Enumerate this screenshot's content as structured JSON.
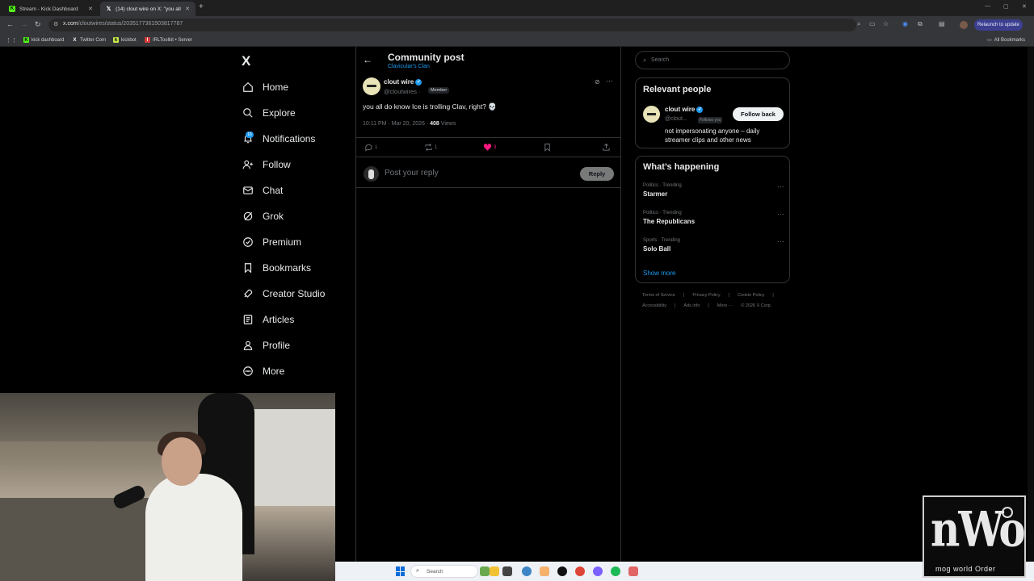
{
  "browser": {
    "tabs": [
      {
        "title": "Stream - Kick Dashboard",
        "favicon": "kick-icon",
        "active": false
      },
      {
        "title": "(14) clout wire on X: \"you all d...",
        "favicon": "x-icon",
        "active": true
      }
    ],
    "url_host": "x.com",
    "url_path": "/cloutwires/status/2035177361503817787",
    "relaunch_label": "Relaunch to update",
    "bookmarks": [
      {
        "label": "kick dashboard",
        "icon": "K"
      },
      {
        "label": "Twitter Com",
        "icon": "X"
      },
      {
        "label": "kickbot",
        "icon": "k"
      },
      {
        "label": "IRLToolkit • Server",
        "icon": "I"
      }
    ],
    "all_bookmarks_label": "All Bookmarks"
  },
  "sidebar": {
    "logo": "X",
    "items": [
      {
        "label": "Home",
        "icon": "home-icon"
      },
      {
        "label": "Explore",
        "icon": "search-icon"
      },
      {
        "label": "Notifications",
        "icon": "bell-icon"
      },
      {
        "label": "Follow",
        "icon": "add-person-icon"
      },
      {
        "label": "Chat",
        "icon": "mail-icon"
      },
      {
        "label": "Grok",
        "icon": "grok-icon"
      },
      {
        "label": "Premium",
        "icon": "verified-icon"
      },
      {
        "label": "Bookmarks",
        "icon": "bookmark-icon"
      },
      {
        "label": "Creator Studio",
        "icon": "rocket-icon"
      },
      {
        "label": "Articles",
        "icon": "article-icon"
      },
      {
        "label": "Profile",
        "icon": "person-icon"
      },
      {
        "label": "More",
        "icon": "more-circle-icon"
      }
    ],
    "notification_count": "16"
  },
  "post": {
    "header_title": "Community post",
    "community": "Clavicular's Clan",
    "author_name": "clout wire",
    "author_handle": "@cloutwires",
    "handle_sep": "·",
    "member_badge": "Member",
    "text": "you all do know Ice is trolling Clav, right? 💀",
    "time": "10:11 PM · Mar 20, 2026 · ",
    "views_count": "408",
    "views_label": " Views",
    "replies": "1",
    "reposts": "1",
    "likes": "3",
    "reply_placeholder": "Post your reply",
    "reply_button": "Reply"
  },
  "right": {
    "search_placeholder": "Search",
    "relevant_title": "Relevant people",
    "person": {
      "name": "clout wire",
      "handle": "@clout...",
      "follows_you": "Follows you",
      "follow_button": "Follow back",
      "bio": "not impersonating anyone – daily streamer clips and other news"
    },
    "happening_title": "What’s happening",
    "trends": [
      {
        "category": "Politics · Trending",
        "title": "Starmer"
      },
      {
        "category": "Politics · Trending",
        "title": "The Republicans"
      },
      {
        "category": "Sports · Trending",
        "title": "Solo Ball"
      }
    ],
    "show_more": "Show more",
    "footer_row1": [
      "Terms of Service",
      "|",
      "Privacy Policy",
      "|",
      "Cookie Policy",
      "|"
    ],
    "footer_row2": [
      "Accessibility",
      "|",
      "Ads info",
      "|",
      "More ···",
      "© 2026 X Corp."
    ]
  },
  "taskbar": {
    "search_label": "Search"
  },
  "overlay": {
    "logo_big": "nWo",
    "logo_small": "mog world Order"
  },
  "colors": {
    "accent": "#1d9bf0",
    "like": "#f91880",
    "background": "#000000",
    "border": "#2f3336"
  }
}
